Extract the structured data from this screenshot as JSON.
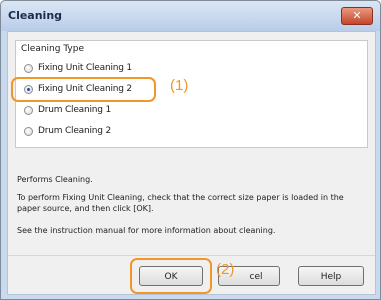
{
  "window": {
    "title": "Cleaning",
    "close_label": "✕"
  },
  "group": {
    "title": "Cleaning Type",
    "options": [
      {
        "label": "Fixing Unit Cleaning 1",
        "checked": false
      },
      {
        "label": "Fixing Unit Cleaning 2",
        "checked": true
      },
      {
        "label": "Drum Cleaning 1",
        "checked": false
      },
      {
        "label": "Drum Cleaning 2",
        "checked": false
      }
    ]
  },
  "info": {
    "line1": "Performs Cleaning.",
    "line2": "To perform Fixing Unit Cleaning, check that the correct size paper is loaded in the paper source, and then click [OK].",
    "line3": "See the instruction manual for more information about cleaning."
  },
  "buttons": {
    "ok": "OK",
    "cancel": "cel",
    "help": "Help"
  },
  "annotations": {
    "one": "(1)",
    "two": "(2)",
    "color": "#f0962a"
  }
}
